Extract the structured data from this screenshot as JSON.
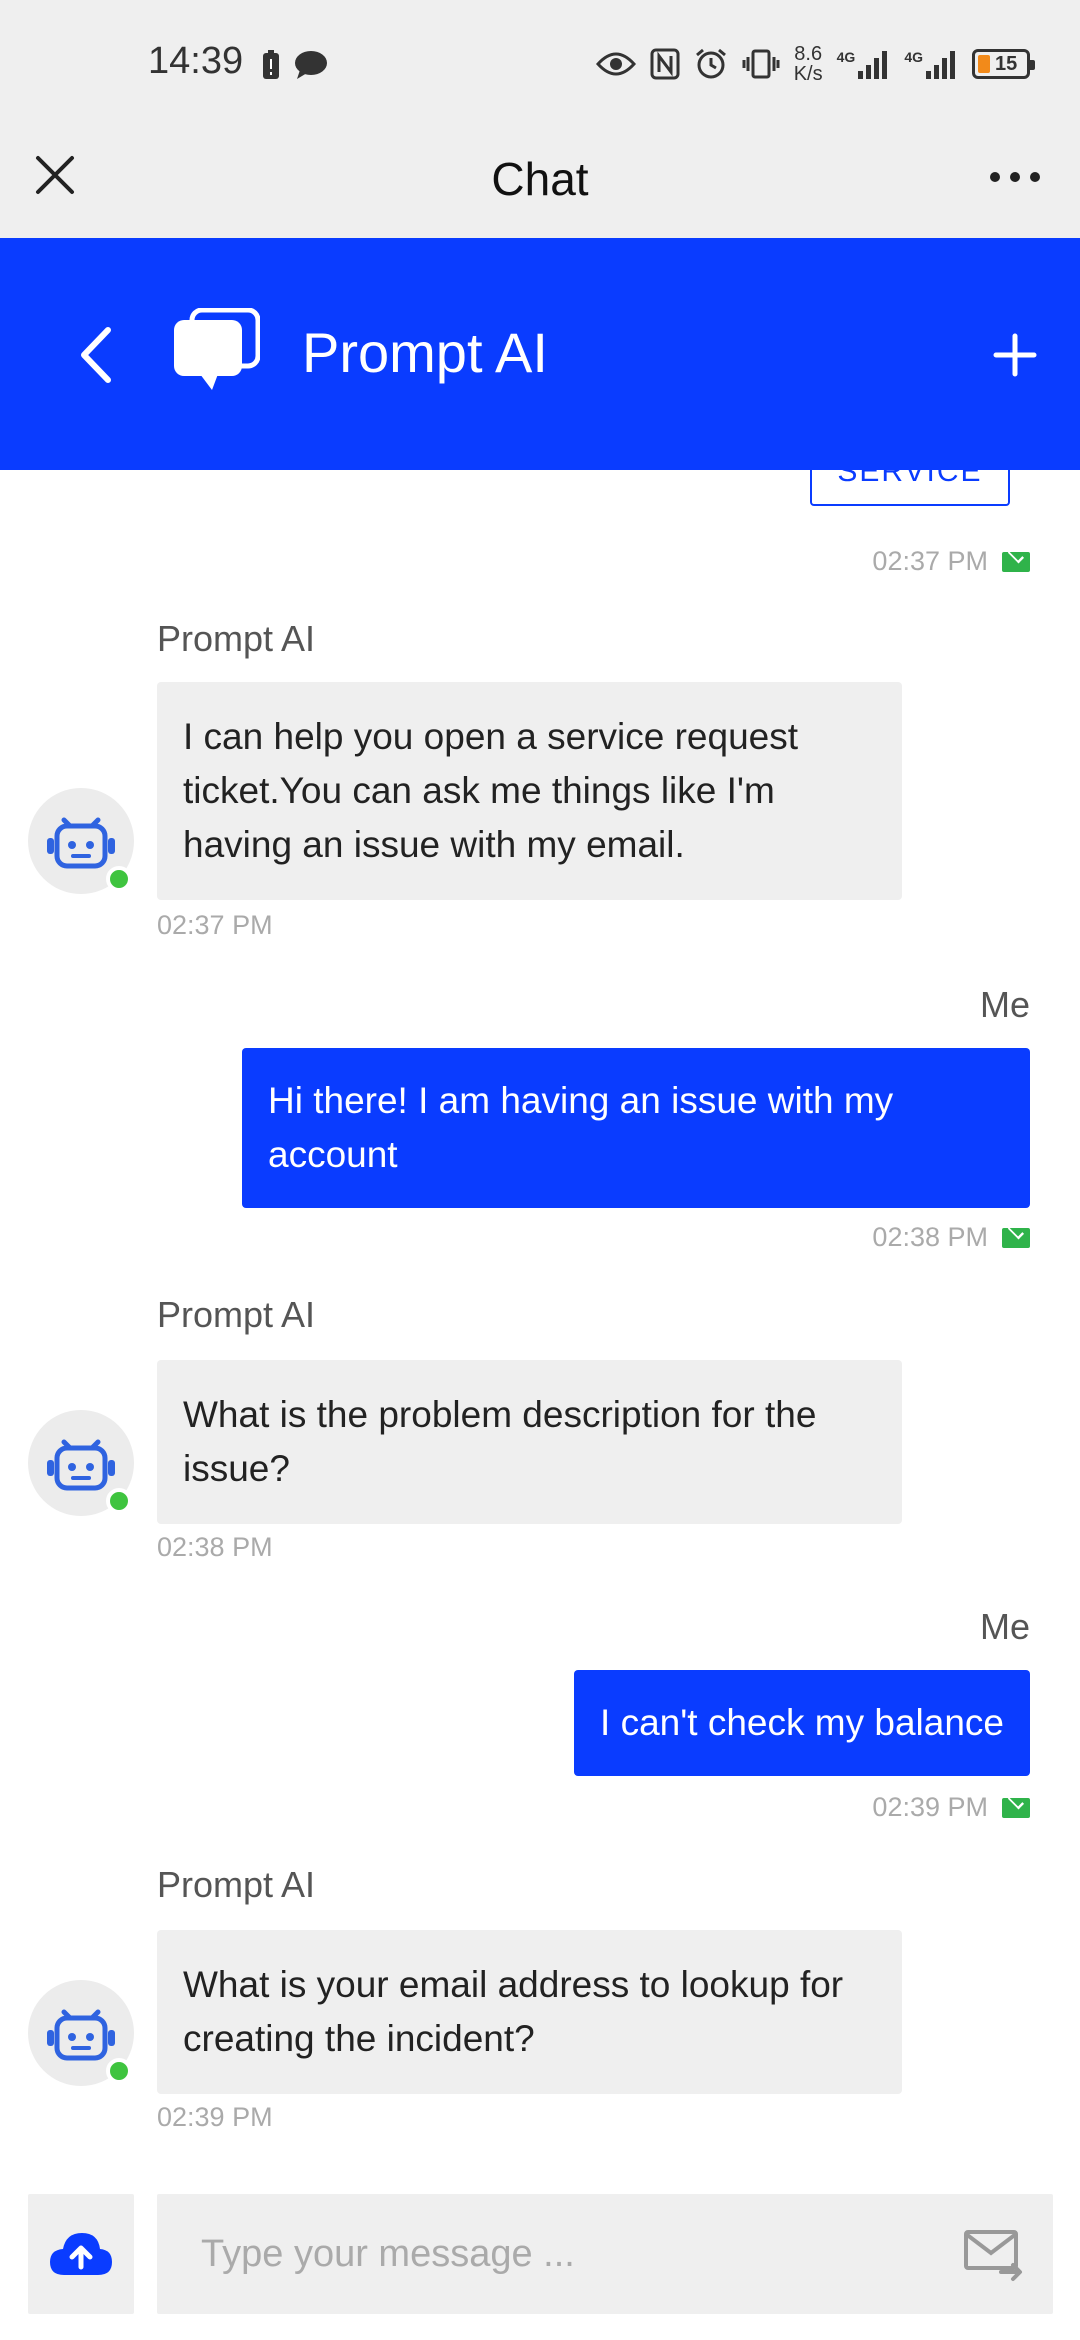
{
  "status_bar": {
    "time": "14:39",
    "net_speed_value": "8.6",
    "net_speed_unit": "K/s",
    "signal_1": "4G",
    "signal_2": "4G",
    "battery": "15",
    "battery_color": "#f28a1a"
  },
  "header": {
    "title": "Chat"
  },
  "chat_bar": {
    "title": "Prompt AI",
    "background": "#0a3cff"
  },
  "conversation": {
    "service_button_label": "SERVICE",
    "first_timestamp": "02:37 PM",
    "messages": [
      {
        "sender": "Prompt AI",
        "text": "I can help you open a service request ticket.You can ask me things like I'm having an issue with my email.",
        "time": "02:37 PM"
      },
      {
        "sender": "Me",
        "text": "Hi there! I am having an issue with my account",
        "time": "02:38 PM"
      },
      {
        "sender": "Prompt AI",
        "text": "What is the problem description for the issue?",
        "time": "02:38 PM"
      },
      {
        "sender": "Me",
        "text": "I can't check my balance",
        "time": "02:39 PM"
      },
      {
        "sender": "Prompt AI",
        "text": "What is your email address to lookup for creating the incident?",
        "time": "02:39 PM"
      }
    ]
  },
  "composer": {
    "placeholder": "Type your message ...",
    "upload_icon": "cloud-upload-icon",
    "send_icon": "send-mail-icon"
  }
}
